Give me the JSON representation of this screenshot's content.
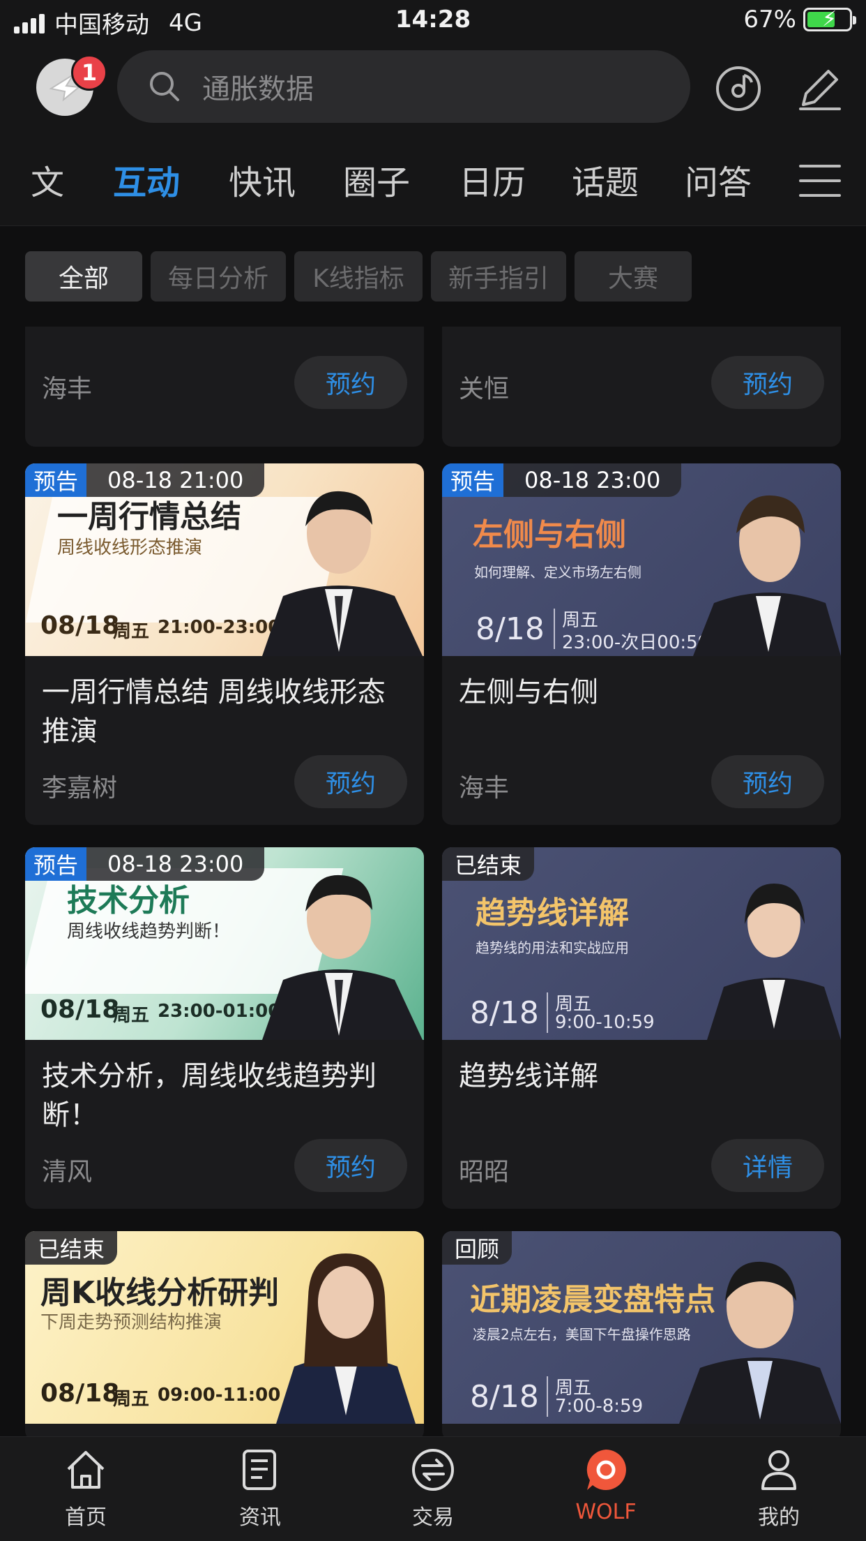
{
  "status_bar": {
    "carrier": "中国移动",
    "network": "4G",
    "time": "14:28",
    "battery": "67%"
  },
  "header": {
    "notification_count": "1",
    "search_placeholder": "通胀数据"
  },
  "tabs": [
    "文",
    "互动",
    "快讯",
    "圈子",
    "日历",
    "话题",
    "问答"
  ],
  "active_tab": "互动",
  "filters": [
    "全部",
    "每日分析",
    "K线指标",
    "新手指引",
    "大赛"
  ],
  "top_partial_cards": [
    {
      "host": "海丰",
      "action": "预约"
    },
    {
      "host": "关恒",
      "action": "预约"
    }
  ],
  "cards": [
    {
      "tag": "预告",
      "time": "08-18 21:00",
      "banner_title": "一周行情总结",
      "banner_sub": "周线收线形态推演",
      "banner_date": "08/18",
      "banner_day": "周五",
      "banner_hours": "21:00-23:00",
      "title": "一周行情总结 周线收线形态推演",
      "host": "李嘉树",
      "action": "预约"
    },
    {
      "tag": "预告",
      "time": "08-18 23:00",
      "banner_title": "左侧与右侧",
      "banner_sub": "如何理解、定义市场左右侧",
      "banner_date": "8/18",
      "banner_day": "周五",
      "banner_hours": "23:00-次日00:59",
      "title": "左侧与右侧",
      "host": "海丰",
      "action": "预约"
    },
    {
      "tag": "预告",
      "time": "08-18 23:00",
      "banner_title": "技术分析",
      "banner_sub": "周线收线趋势判断！",
      "banner_date": "08/18",
      "banner_day": "周五",
      "banner_hours": "23:00-01:00",
      "title": "技术分析，周线收线趋势判断！",
      "host": "清风",
      "action": "预约"
    },
    {
      "tag": "已结束",
      "time": "",
      "banner_title": "趋势线详解",
      "banner_sub": "趋势线的用法和实战应用",
      "banner_date": "8/18",
      "banner_day": "周五",
      "banner_hours": "9:00-10:59",
      "title": "趋势线详解",
      "host": "昭昭",
      "action": "详情"
    },
    {
      "tag": "已结束",
      "time": "",
      "banner_title": "周K收线分析研判",
      "banner_sub": "下周走势预测结构推演",
      "banner_date": "08/18",
      "banner_day": "周五",
      "banner_hours": "09:00-11:00",
      "title": "",
      "host": "",
      "action": ""
    },
    {
      "tag": "回顾",
      "time": "",
      "banner_title": "近期凌晨变盘特点",
      "banner_sub": "凌晨2点左右，美国下午盘操作思路",
      "banner_date": "8/18",
      "banner_day": "周五",
      "banner_hours": "7:00-8:59",
      "title": "",
      "host": "",
      "action": ""
    }
  ],
  "bottom_nav": [
    "首页",
    "资讯",
    "交易",
    "WOLF",
    "我的"
  ],
  "colors": {
    "accent": "#2e8fe6",
    "active_nav": "#f0573b",
    "badge": "#e94148",
    "background": "#0f0f10"
  }
}
